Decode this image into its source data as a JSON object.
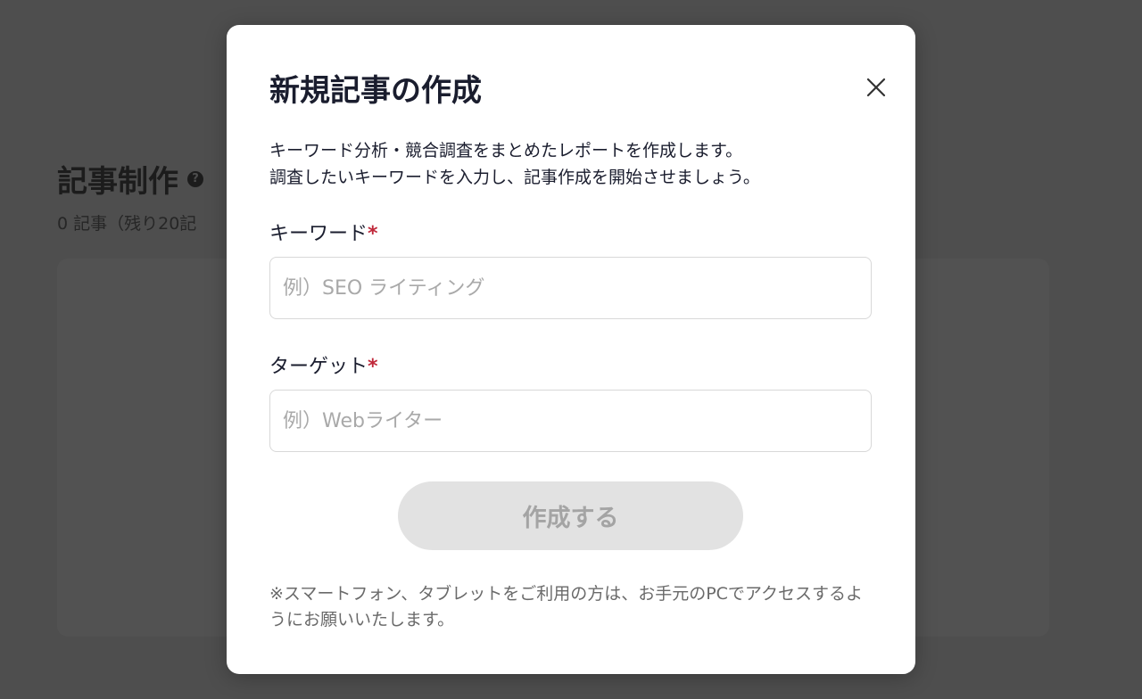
{
  "background": {
    "title": "記事制作",
    "help_icon": "?",
    "count_text": "0 記事（残り20記"
  },
  "modal": {
    "title": "新規記事の作成",
    "close_icon": "close-icon",
    "description_line1": "キーワード分析・競合調査をまとめたレポートを作成します。",
    "description_line2": "調査したいキーワードを入力し、記事作成を開始させましょう。",
    "keyword_label": "キーワード",
    "keyword_required": "*",
    "keyword_placeholder": "例）SEO ライティング",
    "keyword_value": "",
    "target_label": "ターゲット",
    "target_required": "*",
    "target_placeholder": "例）Webライター",
    "target_value": "",
    "submit_label": "作成する",
    "note": "※スマートフォン、タブレットをご利用の方は、お手元のPCでアクセスするようにお願いいたします。"
  },
  "colors": {
    "required_mark": "#c0283a",
    "button_disabled_bg": "#e2e2e2",
    "button_disabled_text": "#a4a4a4",
    "overlay": "#4e4e4e"
  }
}
